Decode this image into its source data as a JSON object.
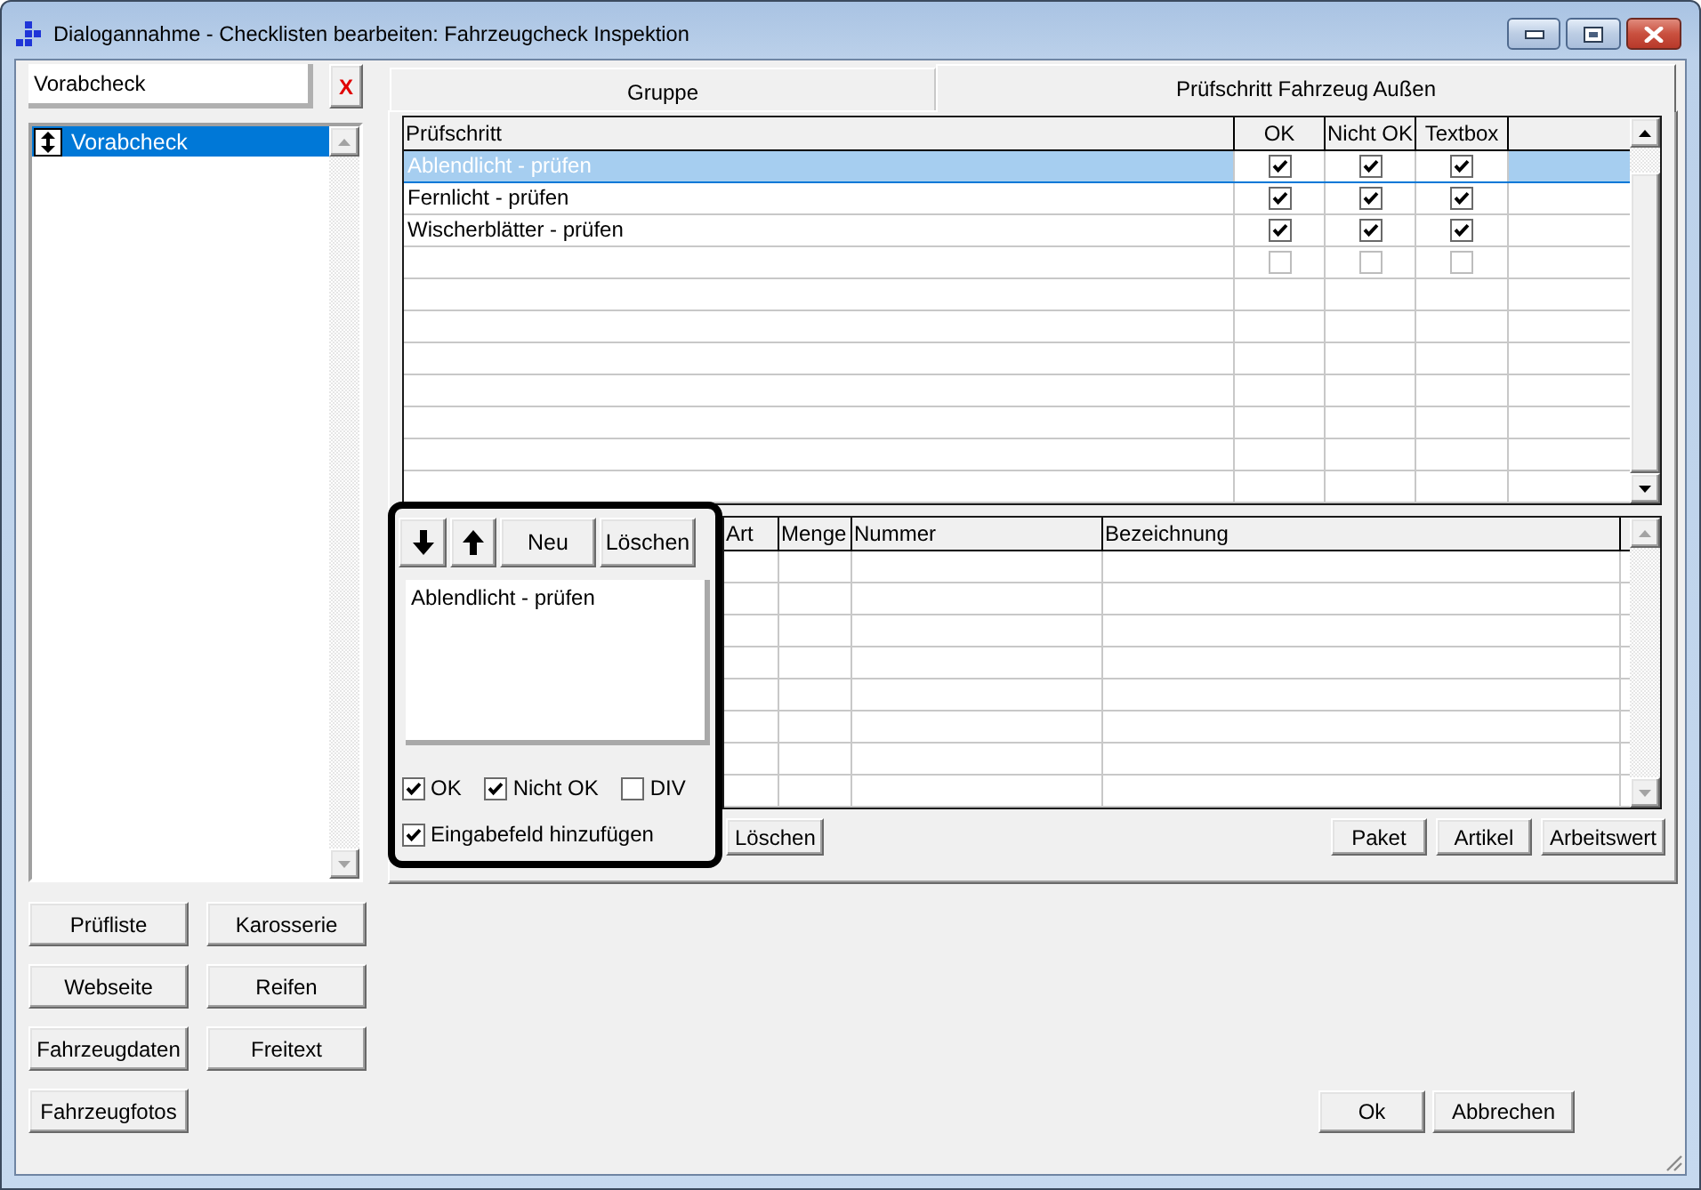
{
  "window": {
    "title": "Dialogannahme - Checklisten bearbeiten: Fahrzeugcheck Inspektion"
  },
  "search": {
    "value": "Vorabcheck",
    "clear_label": "X"
  },
  "groups": [
    {
      "label": "Vorabcheck",
      "selected": true
    }
  ],
  "side_buttons": [
    {
      "label": "Prüfliste"
    },
    {
      "label": "Karosserie"
    },
    {
      "label": "Webseite"
    },
    {
      "label": "Reifen"
    },
    {
      "label": "Fahrzeugdaten"
    },
    {
      "label": "Freitext"
    },
    {
      "label": "Fahrzeugfotos"
    }
  ],
  "tabs": [
    {
      "label": "Gruppe",
      "selected": false
    },
    {
      "label": "Prüfschritt Fahrzeug Außen",
      "selected": true
    }
  ],
  "steps_table": {
    "columns": [
      "Prüfschritt",
      "OK",
      "Nicht OK",
      "Textbox"
    ],
    "rows": [
      {
        "kind": "step",
        "name": "Ablendlicht - prüfen",
        "ok": true,
        "nicht_ok": true,
        "textbox": true,
        "selected": true
      },
      {
        "kind": "step",
        "name": "Fernlicht - prüfen",
        "ok": true,
        "nicht_ok": true,
        "textbox": true,
        "selected": false
      },
      {
        "kind": "step",
        "name": "Wischerblätter - prüfen",
        "ok": true,
        "nicht_ok": true,
        "textbox": true,
        "selected": false
      },
      {
        "kind": "new",
        "ok": false,
        "nicht_ok": false,
        "textbox": false,
        "selected": false
      }
    ]
  },
  "step_editor": {
    "tools": [
      {
        "kind": "move_down"
      },
      {
        "kind": "move_up"
      },
      {
        "kind": "text",
        "label": "Neu"
      },
      {
        "kind": "text",
        "label": "Löschen"
      }
    ],
    "text": "Ablendlicht - prüfen",
    "options": [
      {
        "label": "OK",
        "checked": true
      },
      {
        "label": "Nicht OK",
        "checked": true
      },
      {
        "label": "DIV",
        "checked": false
      }
    ],
    "add_input": {
      "label": "Eingabefeld hinzufügen",
      "checked": true
    }
  },
  "articles_table": {
    "columns": [
      "Art",
      "Menge",
      "Nummer",
      "Bezeichnung"
    ]
  },
  "article_buttons": [
    {
      "kind": "left",
      "label": "Löschen"
    },
    {
      "kind": "right",
      "label": "Paket"
    },
    {
      "kind": "right",
      "label": "Artikel"
    },
    {
      "kind": "right",
      "label": "Arbeitswert"
    }
  ],
  "dialog_buttons": [
    {
      "label": "Ok"
    },
    {
      "label": "Abbrechen"
    }
  ]
}
